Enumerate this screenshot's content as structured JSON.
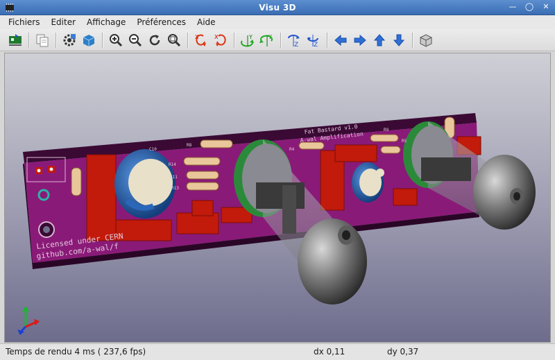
{
  "window": {
    "title": "Visu 3D"
  },
  "menu": [
    {
      "label": "Fichiers"
    },
    {
      "label": "Editer"
    },
    {
      "label": "Affichage"
    },
    {
      "label": "Préférences"
    },
    {
      "label": "Aide"
    }
  ],
  "toolbar": {
    "icons": [
      "pcb-reload-icon",
      "copy-image-icon",
      "settings-icon",
      "render-mode-icon",
      "zoom-in-icon",
      "zoom-out-icon",
      "redraw-icon",
      "zoom-fit-icon",
      "rotate-x-cw-icon",
      "rotate-x-ccw-icon",
      "rotate-y-cw-icon",
      "rotate-y-ccw-icon",
      "rotate-z-cw-icon",
      "rotate-z-ccw-icon",
      "arrow-left-icon",
      "arrow-right-icon",
      "arrow-up-icon",
      "arrow-down-icon",
      "ortho-view-icon"
    ]
  },
  "board": {
    "silkscreen_title": "Fat Bastard v1.0",
    "silkscreen_subtitle": "A-wal Amplification",
    "license_line1": "Licensed under CERN",
    "license_line2": "github.com/a-wal/f",
    "refs": [
      "C10",
      "R8",
      "R14",
      "R11",
      "R13",
      "R9",
      "R5",
      "R4"
    ],
    "colors": {
      "pcb": "#8a1a78",
      "pcb_edge": "#3a0a34",
      "component": "#c21a0b",
      "cap_blue": "#2a67b8",
      "tube_base": "#2b8a3a"
    }
  },
  "status": {
    "render": "Temps de rendu 4 ms ( 237,6 fps)",
    "dx": "dx 0,11",
    "dy": "dy 0,37"
  }
}
